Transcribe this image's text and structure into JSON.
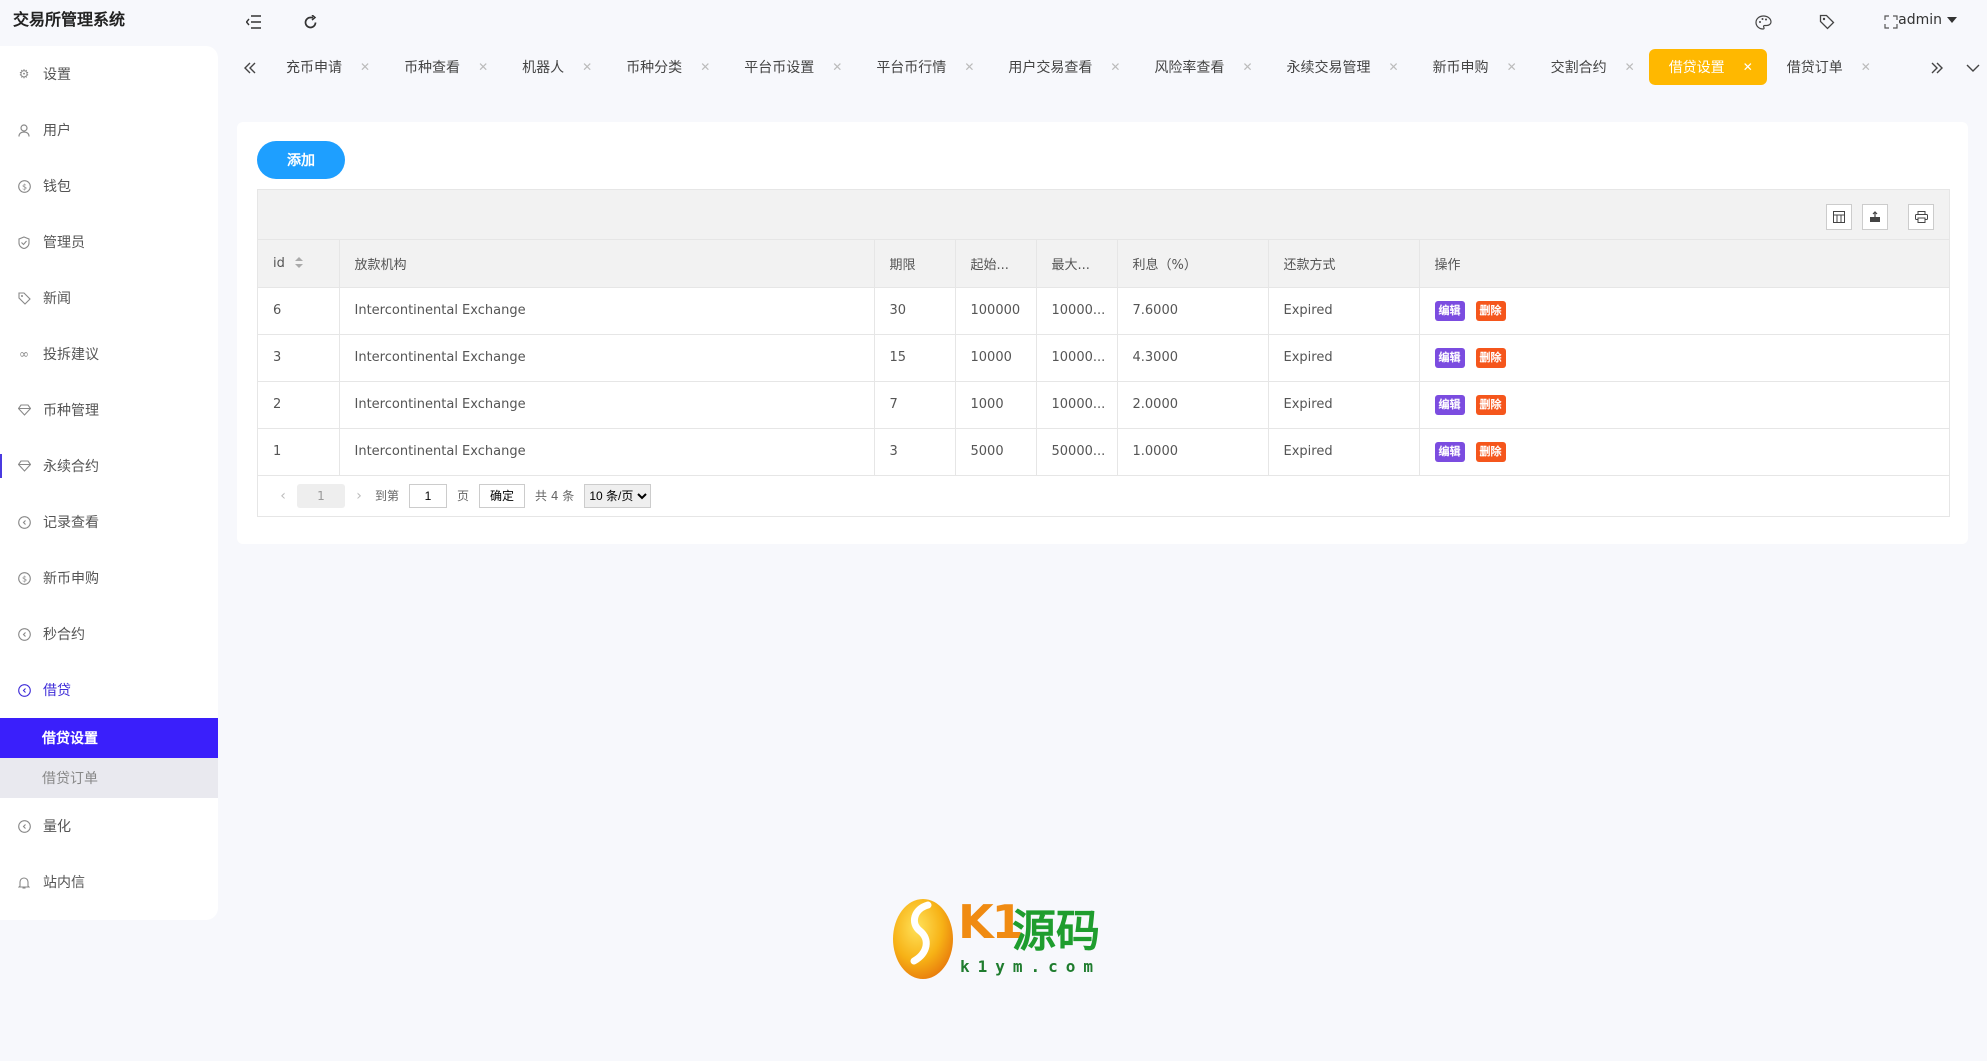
{
  "app": {
    "title": "交易所管理系统"
  },
  "topbar": {
    "user": "admin"
  },
  "sidebar": {
    "items": [
      {
        "label": "设置",
        "icon": "gear-icon"
      },
      {
        "label": "用户",
        "icon": "user-icon"
      },
      {
        "label": "钱包",
        "icon": "dollar-icon"
      },
      {
        "label": "管理员",
        "icon": "shield-icon"
      },
      {
        "label": "新闻",
        "icon": "tag-icon"
      },
      {
        "label": "投拆建议",
        "icon": "link-icon"
      },
      {
        "label": "币种管理",
        "icon": "diamond-icon"
      },
      {
        "label": "永续合约",
        "icon": "diamond-icon"
      },
      {
        "label": "记录查看",
        "icon": "circle-arrow-icon"
      },
      {
        "label": "新币申购",
        "icon": "dollar-icon"
      },
      {
        "label": "秒合约",
        "icon": "circle-arrow-icon"
      },
      {
        "label": "借贷",
        "icon": "circle-arrow-icon"
      }
    ],
    "sub": [
      {
        "label": "借贷设置"
      },
      {
        "label": "借贷订单"
      }
    ],
    "after": [
      {
        "label": "量化",
        "icon": "circle-arrow-icon"
      },
      {
        "label": "站内信",
        "icon": "bell-icon"
      }
    ]
  },
  "tabs": [
    {
      "label": "充币申请"
    },
    {
      "label": "币种查看"
    },
    {
      "label": "机器人"
    },
    {
      "label": "币种分类"
    },
    {
      "label": "平台币设置"
    },
    {
      "label": "平台币行情"
    },
    {
      "label": "用户交易查看"
    },
    {
      "label": "风险率查看"
    },
    {
      "label": "永续交易管理"
    },
    {
      "label": "新币申购"
    },
    {
      "label": "交割合约"
    },
    {
      "label": "借贷设置"
    },
    {
      "label": "借贷订单"
    }
  ],
  "main": {
    "add_label": "添加",
    "columns": [
      "id",
      "放款机构",
      "期限",
      "起始...",
      "最大...",
      "利息（%）",
      "还款方式",
      "操作"
    ],
    "rows": [
      {
        "id": "6",
        "org": "Intercontinental Exchange",
        "term": "30",
        "min": "100000",
        "max": "10000...",
        "rate": "7.6000",
        "repay": "Expired"
      },
      {
        "id": "3",
        "org": "Intercontinental Exchange",
        "term": "15",
        "min": "10000",
        "max": "10000...",
        "rate": "4.3000",
        "repay": "Expired"
      },
      {
        "id": "2",
        "org": "Intercontinental Exchange",
        "term": "7",
        "min": "1000",
        "max": "10000...",
        "rate": "2.0000",
        "repay": "Expired"
      },
      {
        "id": "1",
        "org": "Intercontinental Exchange",
        "term": "3",
        "min": "5000",
        "max": "50000...",
        "rate": "1.0000",
        "repay": "Expired"
      }
    ],
    "edit_label": "编辑",
    "delete_label": "删除"
  },
  "pager": {
    "current": "1",
    "goto_label": "到第",
    "page_input": "1",
    "page_unit": "页",
    "confirm_label": "确定",
    "total_label": "共 4 条",
    "page_size": "10 条/页"
  },
  "watermark": {
    "brand": "K1",
    "brand_cn": "源码",
    "url": "k1ym.com"
  },
  "colors": {
    "accent": "#3a1ffb",
    "active_tab": "#ffb800",
    "add_button": "#1e9fff",
    "edit": "#7b4ce0",
    "delete": "#f5561c"
  }
}
